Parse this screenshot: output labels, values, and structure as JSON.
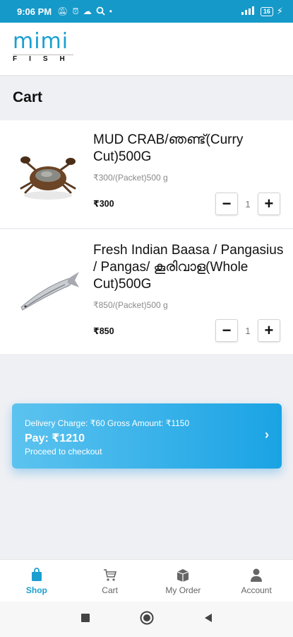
{
  "status_bar": {
    "time": "9:06 PM",
    "battery": "16"
  },
  "header": {
    "logo_top": "mimi",
    "logo_bottom": "FISH"
  },
  "page": {
    "title": "Cart"
  },
  "cart": {
    "items": [
      {
        "name": "MUD CRAB/ഞണ്ട്(Curry Cut)500G",
        "unit_price": "₹300/(Packet)500 g",
        "price": "₹300",
        "quantity": "1",
        "image": "crab-image"
      },
      {
        "name": "Fresh Indian Baasa / Pangasius / Pangas/ കൂരിവാള(Whole Cut)500G",
        "unit_price": "₹850/(Packet)500 g",
        "price": "₹850",
        "quantity": "1",
        "image": "fish-image"
      }
    ],
    "minus_symbol": "−",
    "plus_symbol": "+"
  },
  "checkout": {
    "summary": "Delivery Charge: ₹60 Gross Amount: ₹1150",
    "pay": "Pay: ₹1210",
    "cta": "Proceed to checkout",
    "arrow": "›"
  },
  "bottom_nav": {
    "items": [
      {
        "label": "Shop",
        "icon": "shopping-bag-icon",
        "active": true
      },
      {
        "label": "Cart",
        "icon": "cart-icon",
        "active": false
      },
      {
        "label": "My Order",
        "icon": "order-box-icon",
        "active": false
      },
      {
        "label": "Account",
        "icon": "person-icon",
        "active": false
      }
    ]
  },
  "colors": {
    "brand": "#1a9fd0",
    "status_bar": "#1599c9",
    "background": "#eff0f4"
  }
}
